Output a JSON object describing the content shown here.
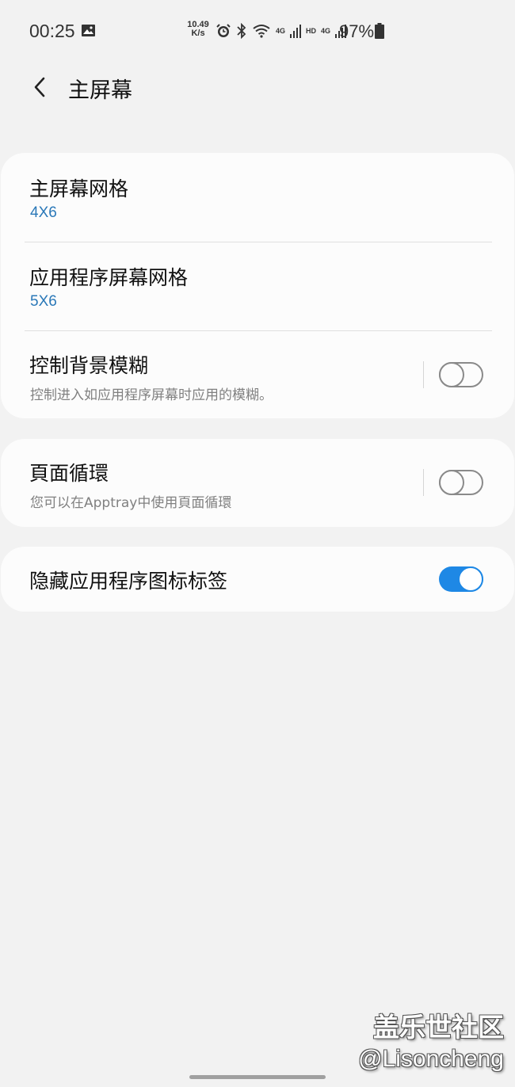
{
  "status_bar": {
    "time": "00:25",
    "net_speed_value": "10.49",
    "net_speed_unit": "K/s",
    "net_label_1": "4G",
    "net_label_hd": "HD",
    "net_label_2": "4G",
    "battery": "97%"
  },
  "header": {
    "title": "主屏幕"
  },
  "settings": {
    "home_grid": {
      "title": "主屏幕网格",
      "value": "4X6"
    },
    "apps_grid": {
      "title": "应用程序屏幕网格",
      "value": "5X6"
    },
    "blur": {
      "title": "控制背景模糊",
      "subtitle": "控制进入如应用程序屏幕时应用的模糊。",
      "enabled": false
    },
    "page_loop": {
      "title": "頁面循環",
      "subtitle": "您可以在Apptray中使用頁面循環",
      "enabled": false
    },
    "hide_labels": {
      "title": "隐藏应用程序图标标签",
      "enabled": true
    }
  },
  "watermark": {
    "line1": "盖乐世社区",
    "line2": "@Lisoncheng"
  },
  "colors": {
    "accent": "#1e88e5",
    "value_text": "#2a78b8",
    "background": "#f2f2f2",
    "card": "#fcfcfc"
  }
}
